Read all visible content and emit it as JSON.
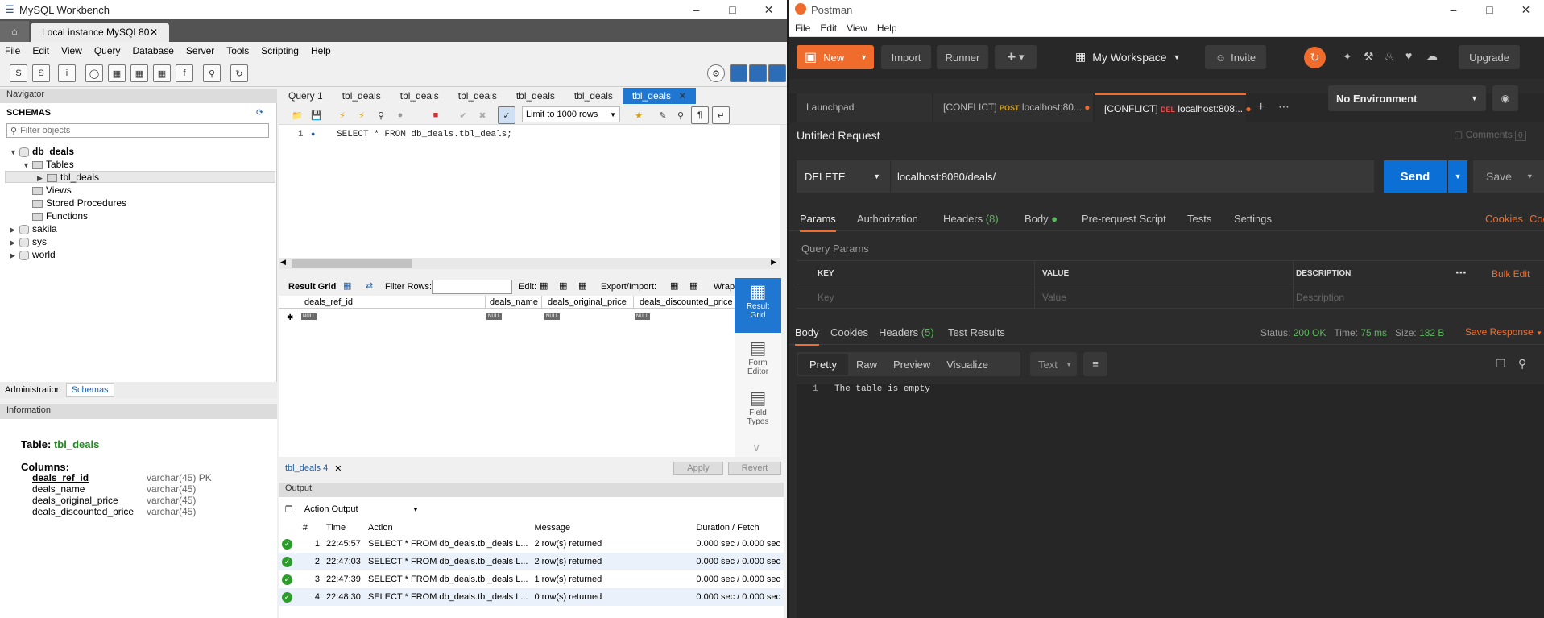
{
  "workbench": {
    "window_title": "MySQL Workbench",
    "connection_tab": "Local instance MySQL80",
    "menu": [
      "File",
      "Edit",
      "View",
      "Query",
      "Database",
      "Server",
      "Tools",
      "Scripting",
      "Help"
    ],
    "navigator_label": "Navigator",
    "schemas_label": "SCHEMAS",
    "filter_placeholder": "Filter objects",
    "tree": {
      "db": "db_deals",
      "tables": "Tables",
      "table": "tbl_deals",
      "views": "Views",
      "procs": "Stored Procedures",
      "funcs": "Functions",
      "others": [
        "sakila",
        "sys",
        "world"
      ]
    },
    "nav_tabs": [
      "Administration",
      "Schemas"
    ],
    "info_label": "Information",
    "info": {
      "table_label": "Table:",
      "table_name": "tbl_deals",
      "columns_label": "Columns:",
      "columns": [
        {
          "name": "deals_ref_id",
          "type": "varchar(45) PK"
        },
        {
          "name": "deals_name",
          "type": "varchar(45)"
        },
        {
          "name": "deals_original_price",
          "type": "varchar(45)"
        },
        {
          "name": "deals_discounted_price",
          "type": "varchar(45)"
        }
      ]
    },
    "query_tabs": [
      "Query 1",
      "tbl_deals",
      "tbl_deals",
      "tbl_deals",
      "tbl_deals",
      "tbl_deals",
      "tbl_deals"
    ],
    "limit_rows": "Limit to 1000 rows",
    "sql_line_no": "1",
    "sql": "SELECT * FROM db_deals.tbl_deals;",
    "result_toolbar": {
      "result_grid": "Result Grid",
      "filter_rows": "Filter Rows:",
      "edit": "Edit:",
      "export": "Export/Import:",
      "wrap": "Wrap"
    },
    "grid_columns": [
      "deals_ref_id",
      "deals_name",
      "deals_original_price",
      "deals_discounted_price"
    ],
    "null_text": "NULL",
    "side": {
      "result_grid": [
        "Result",
        "Grid"
      ],
      "form_editor": [
        "Form",
        "Editor"
      ],
      "field_types": [
        "Field",
        "Types"
      ]
    },
    "result_tab": "tbl_deals 4",
    "apply": "Apply",
    "revert": "Revert",
    "output_label": "Output",
    "action_output": "Action Output",
    "out_headers": [
      "#",
      "Time",
      "Action",
      "Message",
      "Duration / Fetch"
    ],
    "out_rows": [
      {
        "n": "1",
        "time": "22:45:57",
        "action": "SELECT * FROM db_deals.tbl_deals L...",
        "msg": "2 row(s) returned",
        "dur": "0.000 sec / 0.000 sec"
      },
      {
        "n": "2",
        "time": "22:47:03",
        "action": "SELECT * FROM db_deals.tbl_deals L...",
        "msg": "2 row(s) returned",
        "dur": "0.000 sec / 0.000 sec"
      },
      {
        "n": "3",
        "time": "22:47:39",
        "action": "SELECT * FROM db_deals.tbl_deals L...",
        "msg": "1 row(s) returned",
        "dur": "0.000 sec / 0.000 sec"
      },
      {
        "n": "4",
        "time": "22:48:30",
        "action": "SELECT * FROM db_deals.tbl_deals L...",
        "msg": "0 row(s) returned",
        "dur": "0.000 sec / 0.000 sec"
      }
    ]
  },
  "postman": {
    "window_title": "Postman",
    "menu": [
      "File",
      "Edit",
      "View",
      "Help"
    ],
    "new": "New",
    "import": "Import",
    "runner": "Runner",
    "workspace": "My Workspace",
    "invite": "Invite",
    "upgrade": "Upgrade",
    "tabs": [
      {
        "label": "Launchpad"
      },
      {
        "prefix": "[CONFLICT]",
        "method": "POST",
        "url": "localhost:80..."
      },
      {
        "prefix": "[CONFLICT]",
        "method": "DEL",
        "url": "localhost:808..."
      }
    ],
    "environment": "No Environment",
    "request_name": "Untitled Request",
    "comments": "Comments",
    "comments_count": "0",
    "method": "DELETE",
    "url": "localhost:8080/deals/",
    "send": "Send",
    "save": "Save",
    "req_tabs": [
      "Params",
      "Authorization",
      "Headers",
      "Body",
      "Pre-request Script",
      "Tests",
      "Settings"
    ],
    "headers_count": "(8)",
    "cookies": "Cookies",
    "code": "Code",
    "query_params": "Query Params",
    "param_cols": [
      "KEY",
      "VALUE",
      "DESCRIPTION"
    ],
    "bulk_edit": "Bulk Edit",
    "param_placeholders": [
      "Key",
      "Value",
      "Description"
    ],
    "resp_tabs": [
      "Body",
      "Cookies",
      "Headers",
      "Test Results"
    ],
    "resp_headers_count": "(5)",
    "status_label": "Status:",
    "status": "200 OK",
    "time_label": "Time:",
    "time": "75 ms",
    "size_label": "Size:",
    "size": "182 B",
    "save_response": "Save Response",
    "view_modes": [
      "Pretty",
      "Raw",
      "Preview",
      "Visualize"
    ],
    "format": "Text",
    "body_line_no": "1",
    "body": "The table is empty",
    "accent": "#ef6c2c"
  }
}
